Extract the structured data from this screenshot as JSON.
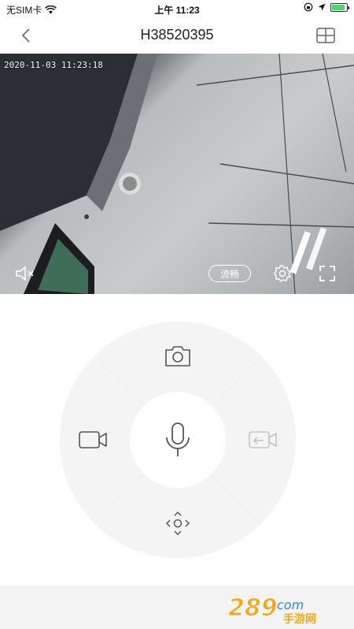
{
  "status_bar": {
    "carrier": "无SIM卡",
    "time": "上午 11:23",
    "battery_level": 0.9,
    "icons": [
      "wifi-icon",
      "orientation-lock-icon",
      "location-icon",
      "battery-icon"
    ]
  },
  "nav": {
    "title": "H38520395",
    "back_icon": "chevron-left-icon",
    "layout_icon": "grid-view-icon"
  },
  "video": {
    "timestamp": "2020-11-03 11:23:18",
    "quality_label": "流畅",
    "icons": [
      "mute-icon",
      "settings-icon",
      "fullscreen-icon"
    ]
  },
  "controls": {
    "center_icon": "microphone-icon",
    "top_icon": "camera-icon",
    "left_icon": "video-record-icon",
    "right_icon": "playback-icon",
    "bottom_icon": "ptz-direction-icon"
  },
  "watermark": {
    "text_main": "289",
    "text_suffix": "com",
    "text_sub": "手游网"
  },
  "colors": {
    "accent_orange": "#f5a623",
    "battery_green": "#4cd964",
    "panel_bg": "#f4f4f4"
  }
}
